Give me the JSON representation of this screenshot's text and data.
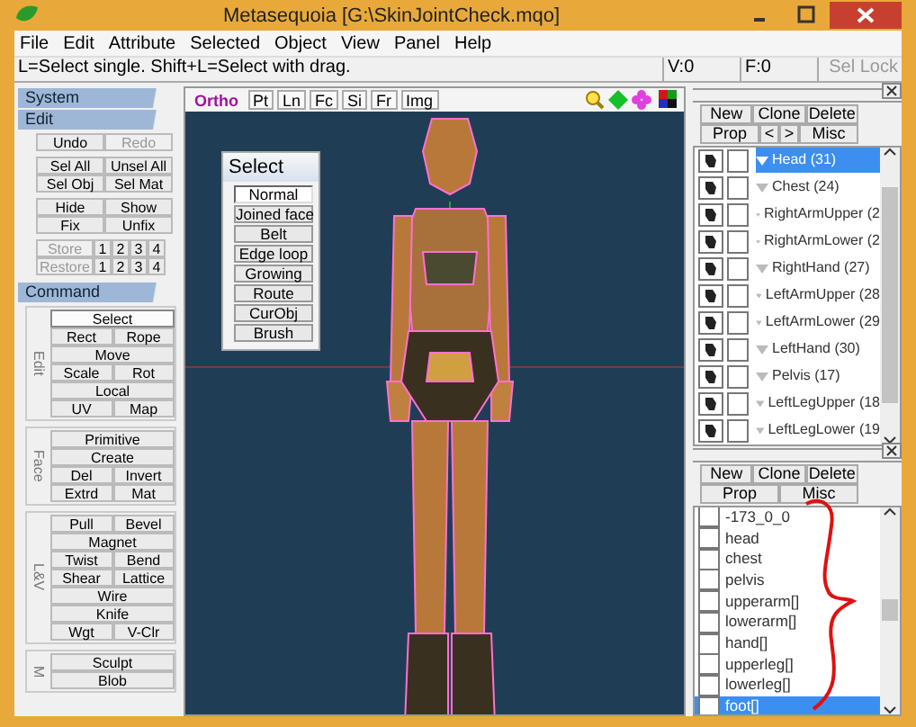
{
  "window": {
    "title": "Metasequoia [G:\\SkinJointCheck.mqo]"
  },
  "menu": [
    "File",
    "Edit",
    "Attribute",
    "Selected",
    "Object",
    "View",
    "Panel",
    "Help"
  ],
  "status": {
    "hint": "L=Select single.  Shift+L=Select with drag.",
    "vertices": "V:0",
    "faces": "F:0",
    "sel_lock": {
      "label": "Sel Lock",
      "disabled": true
    }
  },
  "left_panel": {
    "sections": [
      {
        "title": "System"
      },
      {
        "title": "Edit",
        "rows": [
          [
            {
              "label": "Undo",
              "disabled": false
            },
            {
              "label": "Redo",
              "disabled": true
            }
          ],
          [
            {
              "label": "Sel All",
              "disabled": false
            },
            {
              "label": "Unsel All",
              "disabled": false
            }
          ],
          [
            {
              "label": "Sel Obj",
              "disabled": false
            },
            {
              "label": "Sel Mat",
              "disabled": false
            }
          ],
          [
            {
              "label": "Hide",
              "disabled": false
            },
            {
              "label": "Show",
              "disabled": false
            }
          ],
          [
            {
              "label": "Fix",
              "disabled": false
            },
            {
              "label": "Unfix",
              "disabled": false
            }
          ],
          [
            {
              "label": "Store",
              "disabled": true
            },
            {
              "label": "1",
              "disabled": false
            },
            {
              "label": "2",
              "disabled": false
            },
            {
              "label": "3",
              "disabled": false
            },
            {
              "label": "4",
              "disabled": false
            }
          ],
          [
            {
              "label": "Restore",
              "disabled": true
            },
            {
              "label": "1",
              "disabled": false
            },
            {
              "label": "2",
              "disabled": false
            },
            {
              "label": "3",
              "disabled": false
            },
            {
              "label": "4",
              "disabled": false
            }
          ]
        ]
      },
      {
        "title": "Command",
        "groups": [
          {
            "label": "Edit",
            "rows": [
              [
                {
                  "label": "Select",
                  "selected": true
                }
              ],
              [
                {
                  "label": "Rect",
                  "selected": false
                },
                {
                  "label": "Rope",
                  "selected": false
                }
              ],
              [
                {
                  "label": "Move",
                  "selected": false
                }
              ],
              [
                {
                  "label": "Scale",
                  "selected": false
                },
                {
                  "label": "Rot",
                  "selected": false
                }
              ],
              [
                {
                  "label": "Local",
                  "selected": false
                }
              ],
              [
                {
                  "label": "UV",
                  "selected": false
                },
                {
                  "label": "Map",
                  "selected": false
                }
              ]
            ]
          },
          {
            "label": "Face",
            "rows": [
              [
                {
                  "label": "Primitive",
                  "selected": false
                }
              ],
              [
                {
                  "label": "Create",
                  "selected": false
                }
              ],
              [
                {
                  "label": "Del",
                  "selected": false
                },
                {
                  "label": "Invert",
                  "selected": false
                }
              ],
              [
                {
                  "label": "Extrd",
                  "selected": false
                },
                {
                  "label": "Mat",
                  "selected": false
                }
              ]
            ]
          },
          {
            "label": "L&V",
            "rows": [
              [
                {
                  "label": "Pull",
                  "selected": false
                },
                {
                  "label": "Bevel",
                  "selected": false
                }
              ],
              [
                {
                  "label": "Magnet",
                  "selected": false
                }
              ],
              [
                {
                  "label": "Twist",
                  "selected": false
                },
                {
                  "label": "Bend",
                  "selected": false
                }
              ],
              [
                {
                  "label": "Shear",
                  "selected": false
                },
                {
                  "label": "Lattice",
                  "selected": false
                }
              ],
              [
                {
                  "label": "Wire",
                  "selected": false
                }
              ],
              [
                {
                  "label": "Knife",
                  "selected": false
                }
              ],
              [
                {
                  "label": "Wgt",
                  "selected": false
                },
                {
                  "label": "V-Clr",
                  "selected": false
                }
              ]
            ]
          },
          {
            "label": "M",
            "rows": [
              [
                {
                  "label": "Sculpt",
                  "selected": false
                }
              ],
              [
                {
                  "label": "Blob",
                  "selected": false
                }
              ]
            ]
          }
        ]
      }
    ]
  },
  "viewport": {
    "toolbar": [
      {
        "label": "Ortho",
        "selected": true
      },
      {
        "label": "Pt",
        "selected": false
      },
      {
        "label": "Ln",
        "selected": false
      },
      {
        "label": "Fc",
        "selected": false
      },
      {
        "label": "Si",
        "selected": false
      },
      {
        "label": "Fr",
        "selected": false
      },
      {
        "label": "Img",
        "selected": false
      }
    ],
    "select_palette": {
      "title": "Select",
      "items": [
        {
          "label": "Normal",
          "selected": true
        },
        {
          "label": "Joined face",
          "selected": false
        },
        {
          "label": "Belt",
          "selected": false
        },
        {
          "label": "Edge loop",
          "selected": false
        },
        {
          "label": "Growing",
          "selected": false
        },
        {
          "label": "Route",
          "selected": false
        },
        {
          "label": "CurObj",
          "selected": false
        },
        {
          "label": "Brush",
          "selected": false
        }
      ]
    }
  },
  "object_panel": {
    "buttons": [
      [
        "New",
        "Clone",
        "Delete"
      ],
      [
        "Prop",
        "<",
        ">",
        "Misc"
      ]
    ],
    "objects": [
      {
        "name": "Head (31)",
        "visible": true,
        "selected": true
      },
      {
        "name": "Chest (24)",
        "visible": true,
        "selected": false
      },
      {
        "name": "RightArmUpper (2",
        "visible": true,
        "selected": false
      },
      {
        "name": "RightArmLower (2",
        "visible": true,
        "selected": false
      },
      {
        "name": "RightHand (27)",
        "visible": true,
        "selected": false
      },
      {
        "name": "LeftArmUpper (28",
        "visible": true,
        "selected": false
      },
      {
        "name": "LeftArmLower (29",
        "visible": true,
        "selected": false
      },
      {
        "name": "LeftHand (30)",
        "visible": true,
        "selected": false
      },
      {
        "name": "Pelvis (17)",
        "visible": true,
        "selected": false
      },
      {
        "name": "LeftLegUpper (18",
        "visible": true,
        "selected": false
      },
      {
        "name": "LeftLegLower (19",
        "visible": true,
        "selected": false
      }
    ]
  },
  "material_panel": {
    "buttons": [
      [
        "New",
        "Clone",
        "Delete"
      ],
      [
        "Prop",
        "Misc"
      ]
    ],
    "materials": [
      {
        "name": "-173_0_0",
        "selected": false
      },
      {
        "name": "head",
        "selected": false
      },
      {
        "name": "chest",
        "selected": false
      },
      {
        "name": "pelvis",
        "selected": false
      },
      {
        "name": "upperarm[]",
        "selected": false
      },
      {
        "name": "lowerarm[]",
        "selected": false
      },
      {
        "name": "hand[]",
        "selected": false
      },
      {
        "name": "upperleg[]",
        "selected": false
      },
      {
        "name": "lowerleg[]",
        "selected": false
      },
      {
        "name": "foot[]",
        "selected": true
      }
    ]
  }
}
